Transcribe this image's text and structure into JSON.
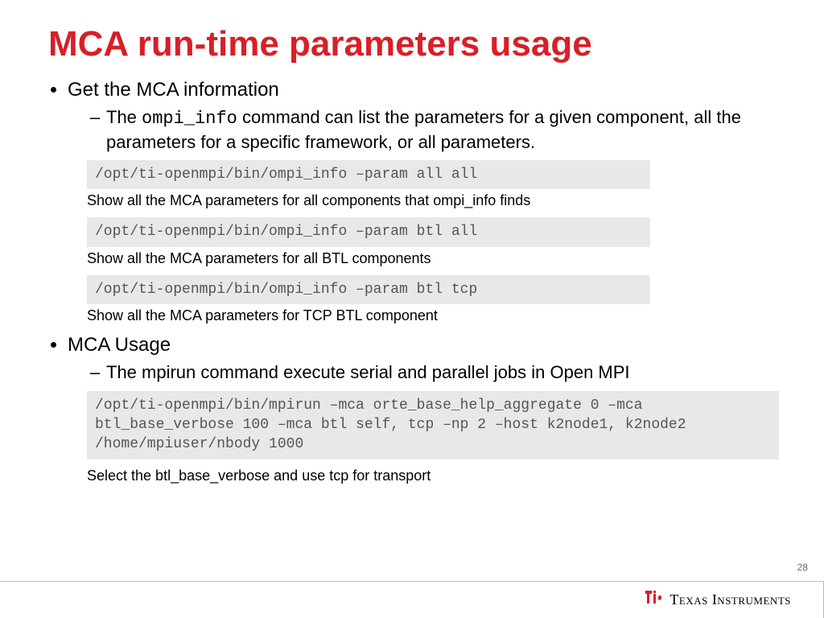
{
  "title": "MCA run-time parameters usage",
  "bullets": {
    "b1": {
      "text": "Get the MCA information",
      "sub_pre": "The ",
      "sub_cmd": "ompi_info",
      "sub_post": " command can list the parameters for a given component, all the parameters for a specific framework, or all parameters."
    },
    "b2": {
      "text": "MCA Usage",
      "sub": "The mpirun command execute serial and parallel jobs in Open MPI"
    }
  },
  "code1": "/opt/ti-openmpi/bin/ompi_info –param all all",
  "cap1": "Show all the MCA parameters for all components that ompi_info finds",
  "code2": "/opt/ti-openmpi/bin/ompi_info –param btl all",
  "cap2": "Show all the MCA parameters for all BTL components",
  "code3": "/opt/ti-openmpi/bin/ompi_info –param btl tcp",
  "cap3": "Show all the MCA parameters for TCP BTL component",
  "code4": "/opt/ti-openmpi/bin/mpirun –mca orte_base_help_aggregate 0 –mca btl_base_verbose 100 –mca btl self, tcp –np 2 –host k2node1, k2node2 /home/mpiuser/nbody 1000",
  "cap4": "Select the btl_base_verbose and use tcp for transport",
  "page": "28",
  "footer": {
    "brand": "Texas Instruments"
  }
}
